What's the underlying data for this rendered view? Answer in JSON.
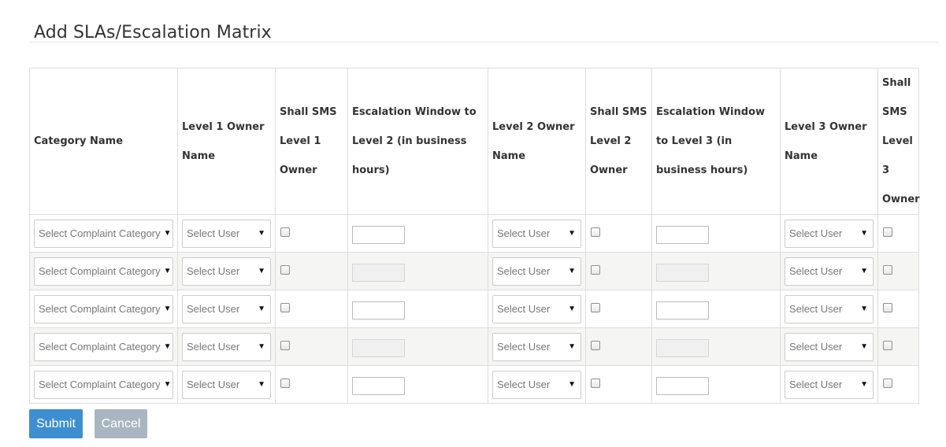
{
  "page": {
    "title": "Add SLAs/Escalation Matrix"
  },
  "table": {
    "headers": [
      "Category Name",
      "Level 1 Owner Name",
      "Shall SMS Level 1 Owner",
      "Escalation Window to Level 2 (in business hours)",
      "Level 2 Owner Name",
      "Shall SMS Level 2 Owner",
      "Escalation Window to Level 3 (in business hours)",
      "Level 3 Owner Name",
      "Shall SMS Level 3 Owner"
    ],
    "row_count": 5,
    "category_placeholder": "Select Complaint Category",
    "user_placeholder": "Select User",
    "rows": [
      {
        "category": "Select Complaint Category",
        "level1_owner": "Select User",
        "sms_level1": false,
        "window_level2": "",
        "level2_owner": "Select User",
        "sms_level2": false,
        "window_level3": "",
        "level3_owner": "Select User",
        "sms_level3": false
      },
      {
        "category": "Select Complaint Category",
        "level1_owner": "Select User",
        "sms_level1": false,
        "window_level2": "",
        "level2_owner": "Select User",
        "sms_level2": false,
        "window_level3": "",
        "level3_owner": "Select User",
        "sms_level3": false
      },
      {
        "category": "Select Complaint Category",
        "level1_owner": "Select User",
        "sms_level1": false,
        "window_level2": "",
        "level2_owner": "Select User",
        "sms_level2": false,
        "window_level3": "",
        "level3_owner": "Select User",
        "sms_level3": false
      },
      {
        "category": "Select Complaint Category",
        "level1_owner": "Select User",
        "sms_level1": false,
        "window_level2": "",
        "level2_owner": "Select User",
        "sms_level2": false,
        "window_level3": "",
        "level3_owner": "Select User",
        "sms_level3": false
      },
      {
        "category": "Select Complaint Category",
        "level1_owner": "Select User",
        "sms_level1": false,
        "window_level2": "",
        "level2_owner": "Select User",
        "sms_level2": false,
        "window_level3": "",
        "level3_owner": "Select User",
        "sms_level3": false
      }
    ]
  },
  "icons": {
    "dropdown": "caret-down-icon"
  },
  "buttons": {
    "submit_label": "Submit",
    "cancel_label": "Cancel"
  },
  "colors": {
    "submit_bg": "#3d8fd1",
    "cancel_bg": "#a9b6c2",
    "stripe_bg": "#f5f5f3",
    "border": "#dddddd"
  }
}
